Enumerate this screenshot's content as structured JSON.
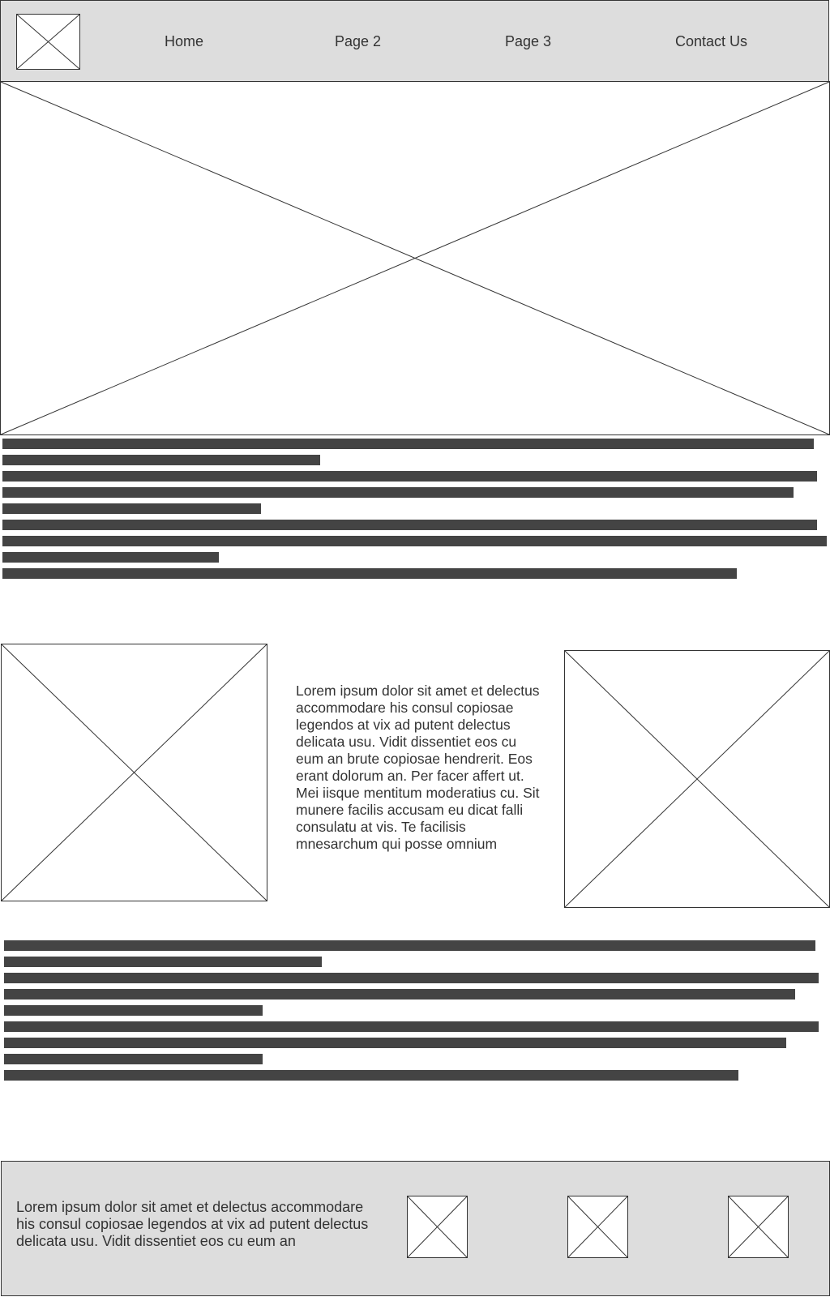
{
  "header": {
    "logo_icon": "image-placeholder-icon",
    "nav": [
      {
        "label": "Home"
      },
      {
        "label": "Page 2"
      },
      {
        "label": "Page 3"
      },
      {
        "label": "Contact Us"
      }
    ]
  },
  "hero": {
    "image_icon": "image-placeholder-icon"
  },
  "content": {
    "middle_text": "Lorem ipsum dolor sit amet et delectus accommodare his consul copiosae legendos at vix ad putent delectus delicata usu. Vidit dissentiet eos cu eum an brute copiosae hendrerit. Eos erant dolorum an. Per facer affert ut. Mei iisque mentitum moderatius cu. Sit munere facilis accusam eu dicat falli consulatu at vis. Te facilisis mnesarchum qui posse omnium"
  },
  "footer": {
    "text": "Lorem ipsum dolor sit amet et delectus accommodare his consul copiosae legendos at vix ad putent delectus delicata usu. Vidit dissentiet eos cu eum an"
  },
  "colors": {
    "header_background": "#dddddd",
    "footer_background": "#dddddd",
    "text_bar": "#444444",
    "text": "#333333",
    "border": "#333333"
  }
}
